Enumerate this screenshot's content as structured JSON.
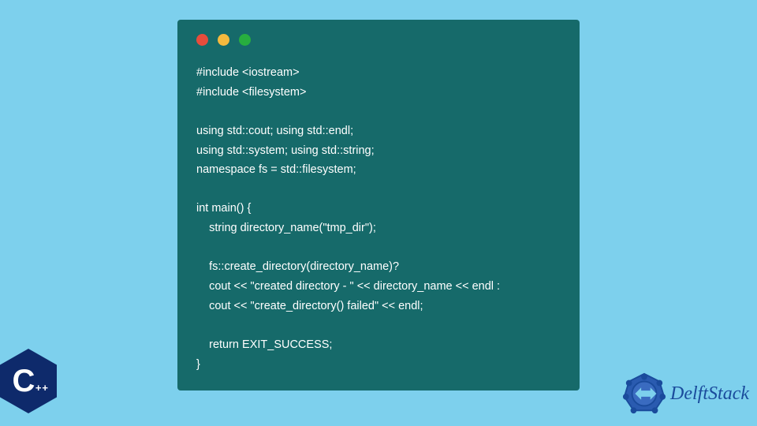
{
  "code": {
    "lines": [
      "#include <iostream>",
      "#include <filesystem>",
      "",
      "using std::cout; using std::endl;",
      "using std::system; using std::string;",
      "namespace fs = std::filesystem;",
      "",
      "int main() {",
      "    string directory_name(\"tmp_dir\");",
      "",
      "    fs::create_directory(directory_name)?",
      "    cout << \"created directory - \" << directory_name << endl :",
      "    cout << \"create_directory() failed\" << endl;",
      "",
      "    return EXIT_SUCCESS;",
      "}"
    ]
  },
  "logos": {
    "cpp": {
      "main": "C",
      "suffix": "++"
    },
    "delftstack": {
      "text": "DelftStack"
    }
  }
}
